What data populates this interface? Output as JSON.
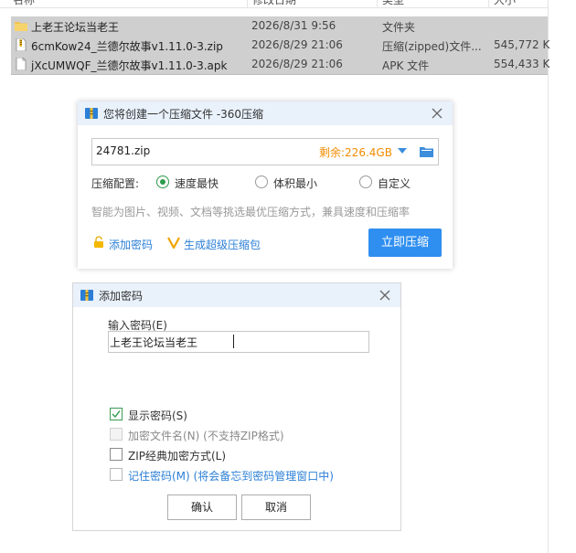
{
  "explorer": {
    "columns": {
      "name": "名称",
      "date": "修改日期",
      "type": "类型",
      "size": "大小"
    },
    "files": [
      {
        "icon": "folder-icon",
        "name": "上老王论坛当老王",
        "date": "2026/8/31 9:56",
        "type": "文件夹",
        "size": ""
      },
      {
        "icon": "zip-file-icon",
        "name": "6cmKow24_兰德尔故事v1.11.0-3.zip",
        "date": "2026/8/29 21:06",
        "type": "压缩(zipped)文件...",
        "size": "545,772 K"
      },
      {
        "icon": "apk-file-icon",
        "name": "jXcUMWQF_兰德尔故事v1.11.0-3.apk",
        "date": "2026/8/29 21:06",
        "type": "APK 文件",
        "size": "554,433 K"
      }
    ]
  },
  "compress_dialog": {
    "title": "您将创建一个压缩文件 -360压缩",
    "filename": "24781.zip",
    "remaining": "剩余:226.4GB",
    "config_label": "压缩配置:",
    "options": [
      "速度最快",
      "体积最小",
      "自定义"
    ],
    "selected_option": "速度最快",
    "hint": "智能为图片、视频、文档等挑选最优压缩方式，兼具速度和压缩率",
    "add_password_link": "添加密码",
    "super_compress_link": "生成超级压缩包",
    "compress_button": "立即压缩"
  },
  "password_dialog": {
    "title": "添加密码",
    "input_label": "输入密码(E)",
    "password_value": "上老王论坛当老王",
    "checkboxes": [
      {
        "label": "显示密码(S)",
        "checked": true,
        "disabled": false
      },
      {
        "label": "加密文件名(N) (不支持ZIP格式)",
        "checked": false,
        "disabled": true
      },
      {
        "label": "ZIP经典加密方式(L)",
        "checked": false,
        "disabled": false
      },
      {
        "label": "记住密码(M) (将会备忘到密码管理窗口中)",
        "checked": false,
        "disabled": false
      }
    ],
    "ok_button": "确认",
    "cancel_button": "取消"
  },
  "colors": {
    "accent_blue": "#2f8ff0",
    "link_blue": "#2b7fd6",
    "orange": "#f08c00",
    "check_green": "#2f9a4c",
    "title_bar": "#e9f1fb",
    "row_selected": "#cfcfcf"
  }
}
